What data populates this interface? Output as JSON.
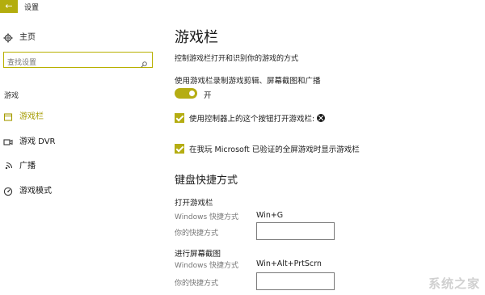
{
  "window": {
    "title": "设置",
    "back_glyph": "←"
  },
  "sidebar": {
    "home_label": "主页",
    "search_placeholder": "查找设置",
    "section_label": "游戏",
    "items": [
      {
        "label": "游戏栏",
        "icon": "gamebar-icon",
        "active": true
      },
      {
        "label": "游戏 DVR",
        "icon": "dvr-icon",
        "active": false
      },
      {
        "label": "广播",
        "icon": "broadcast-icon",
        "active": false
      },
      {
        "label": "游戏模式",
        "icon": "game-mode-icon",
        "active": false
      }
    ]
  },
  "main": {
    "title": "游戏栏",
    "description": "控制游戏栏打开和识别你的游戏的方式",
    "record_label": "使用游戏栏录制游戏剪辑、屏幕截图和广播",
    "toggle": {
      "state": "on",
      "label": "开"
    },
    "checkbox_controller": {
      "checked": true,
      "label": "使用控制器上的这个按钮打开游戏栏:"
    },
    "checkbox_fullscreen": {
      "checked": true,
      "label": "在我玩 Microsoft 已验证的全屏游戏时显示游戏栏"
    },
    "keyboard_section_title": "键盘快捷方式",
    "shortcuts": [
      {
        "group_title": "打开游戏栏",
        "windows_label": "Windows 快捷方式",
        "windows_value": "Win+G",
        "custom_label": "你的快捷方式",
        "custom_value": ""
      },
      {
        "group_title": "进行屏幕截图",
        "windows_label": "Windows 快捷方式",
        "windows_value": "Win+Alt+PrtScrn",
        "custom_label": "你的快捷方式",
        "custom_value": ""
      }
    ]
  },
  "watermark": {
    "text": "系统之家"
  },
  "colors": {
    "accent": "#b5ad12",
    "active_text": "#a59b00",
    "watermark": "#787878"
  }
}
